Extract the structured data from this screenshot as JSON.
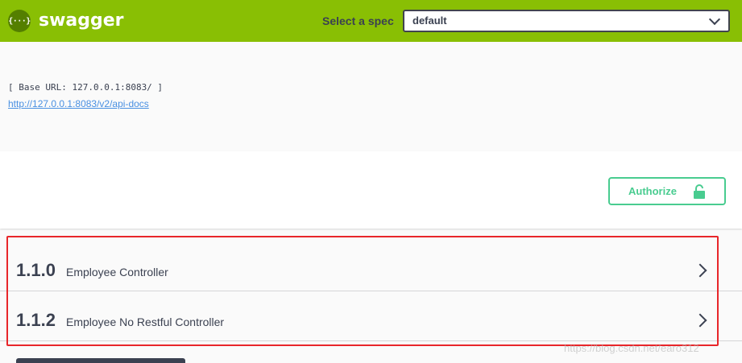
{
  "topbar": {
    "logo_glyph": "{···}",
    "logo_text": "swagger",
    "spec_label": "Select a spec",
    "spec_value": "default",
    "colors": {
      "bar": "#89bf04",
      "logo_circle": "#547f00"
    }
  },
  "info": {
    "base_url": "[ Base URL: 127.0.0.1:8083/ ]",
    "api_docs_link": "http://127.0.0.1:8083/v2/api-docs"
  },
  "auth": {
    "authorize_label": "Authorize",
    "lock_icon": "lock-icon",
    "accent_color": "#49cc90"
  },
  "tags": [
    {
      "name": "1.1.0",
      "description": "Employee Controller"
    },
    {
      "name": "1.1.2",
      "description": "Employee No Restful Controller"
    }
  ],
  "watermark": "https://blog.csdn.net/earo312"
}
